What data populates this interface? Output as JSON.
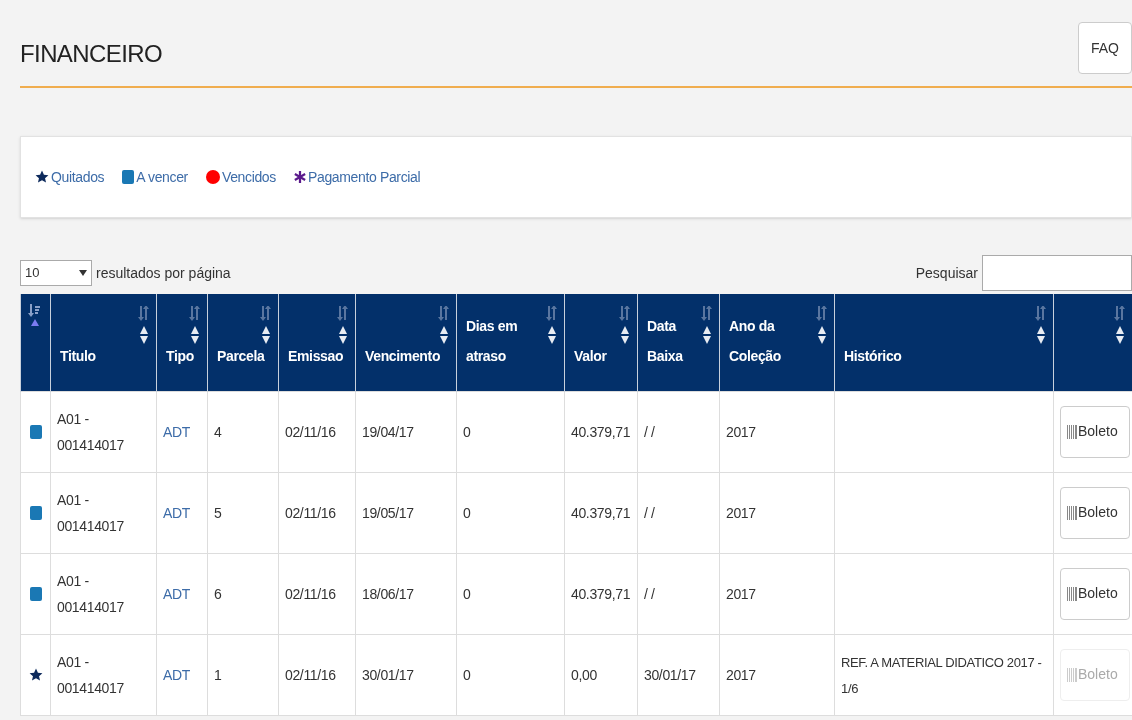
{
  "page_title": "FINANCEIRO",
  "faq_button": "FAQ",
  "legend": [
    {
      "kind": "star",
      "label": "Quitados",
      "color": "#0d2a5c"
    },
    {
      "kind": "square",
      "label": "A vencer",
      "color": "#1a78b4"
    },
    {
      "kind": "circle",
      "label": "Vencidos",
      "color": "#ff0000"
    },
    {
      "kind": "asterisk",
      "label": "Pagamento Parcial",
      "color": "#5b1a8c"
    }
  ],
  "page_size": {
    "value": "10",
    "label": "resultados por página"
  },
  "search": {
    "label": "Pesquisar"
  },
  "table": {
    "columns": [
      {
        "sorted": true
      },
      {
        "label": "Titulo",
        "sorted": false
      },
      {
        "label": "Tipo",
        "sorted": false
      },
      {
        "label": "Parcela",
        "sorted": false
      },
      {
        "label": "Emissao",
        "sorted": false
      },
      {
        "label": "Vencimento",
        "sorted": false
      },
      {
        "label": "Dias em atraso",
        "sorted": false
      },
      {
        "label": "Valor",
        "sorted": false
      },
      {
        "label": "Data Baixa",
        "sorted": false
      },
      {
        "label": "Ano da Coleção",
        "sorted": false
      },
      {
        "label": "Histórico",
        "sorted": false
      },
      {
        "sorted": false
      }
    ],
    "rows": [
      {
        "kind": "square",
        "titulo": "A01 - 001414017",
        "tipo": "ADT",
        "parcela": "4",
        "emissao": "02/11/16",
        "vencimento": "19/04/17",
        "dias": "0",
        "valor": "40.379,71",
        "baixa": "/ /",
        "ano": "2017",
        "boleto": "Boleto",
        "disabled": false
      },
      {
        "kind": "square",
        "titulo": "A01 - 001414017",
        "tipo": "ADT",
        "parcela": "5",
        "emissao": "02/11/16",
        "vencimento": "19/05/17",
        "dias": "0",
        "valor": "40.379,71",
        "baixa": "/ /",
        "ano": "2017",
        "boleto": "Boleto",
        "disabled": false
      },
      {
        "kind": "square",
        "titulo": "A01 - 001414017",
        "tipo": "ADT",
        "parcela": "6",
        "emissao": "02/11/16",
        "vencimento": "18/06/17",
        "dias": "0",
        "valor": "40.379,71",
        "baixa": "/ /",
        "ano": "2017",
        "boleto": "Boleto",
        "disabled": false
      },
      {
        "kind": "star",
        "titulo": "A01 - 001414017",
        "tipo": "ADT",
        "parcela": "1",
        "emissao": "02/11/16",
        "vencimento": "30/01/17",
        "dias": "0",
        "valor": "0,00",
        "baixa": "30/01/17",
        "ano": "2017",
        "historico": "REF. A MATERIAL DIDATICO 2017 - 1/6",
        "boleto": "Boleto",
        "disabled": true
      }
    ]
  }
}
